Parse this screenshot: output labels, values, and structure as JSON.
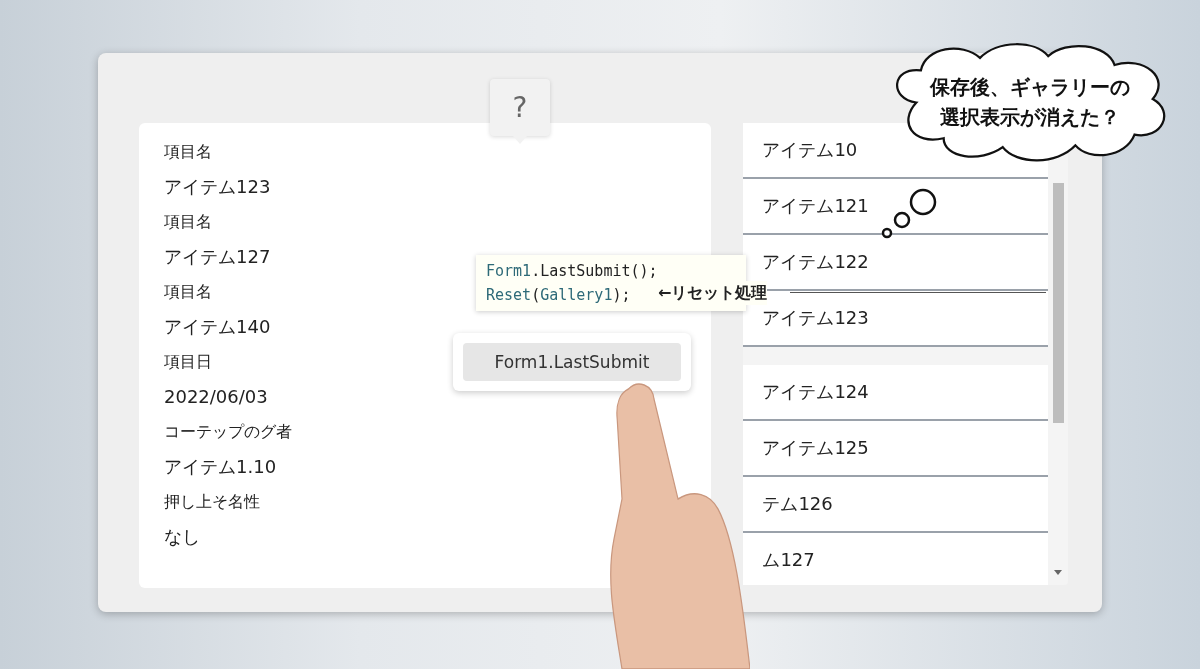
{
  "help_button": {
    "label": "?"
  },
  "form": {
    "fields": [
      {
        "label": "項目名",
        "value": "アイテム123"
      },
      {
        "label": "項目名",
        "value": "アイテム127"
      },
      {
        "label": "項目名",
        "value": "アイテム140"
      },
      {
        "label": "項目日",
        "value": "2022/06/03"
      },
      {
        "label": "コーテップのグ者",
        "value": "アイテム1.10"
      },
      {
        "label": "押し上そ名性",
        "value": "なし"
      }
    ]
  },
  "code_note": {
    "lines": [
      {
        "tokens": [
          {
            "kind": "identifier",
            "text": "Form1"
          },
          {
            "kind": "plain",
            "text": ".LastSubmit();"
          }
        ]
      },
      {
        "tokens": [
          {
            "kind": "identifier",
            "text": "Reset"
          },
          {
            "kind": "plain",
            "text": "("
          },
          {
            "kind": "identifier",
            "text": "Gallery1"
          },
          {
            "kind": "plain",
            "text": ");"
          }
        ]
      }
    ],
    "annotation": "←リセット処理"
  },
  "submit_button": {
    "label": "Form1.LastSubmit"
  },
  "gallery": {
    "groups": [
      {
        "items": [
          {
            "title": "アイテム10"
          },
          {
            "title": "アイテム121"
          },
          {
            "title": "アイテム122"
          },
          {
            "title": "アイテム123"
          }
        ]
      },
      {
        "items": [
          {
            "title": "アイテム124"
          },
          {
            "title": "アイテム125"
          },
          {
            "title": "テム126"
          },
          {
            "title": "ム127"
          }
        ]
      }
    ]
  },
  "thought_bubble": {
    "lines": [
      "保存後、ギャラリーの",
      "選択表示が消えた？"
    ]
  }
}
